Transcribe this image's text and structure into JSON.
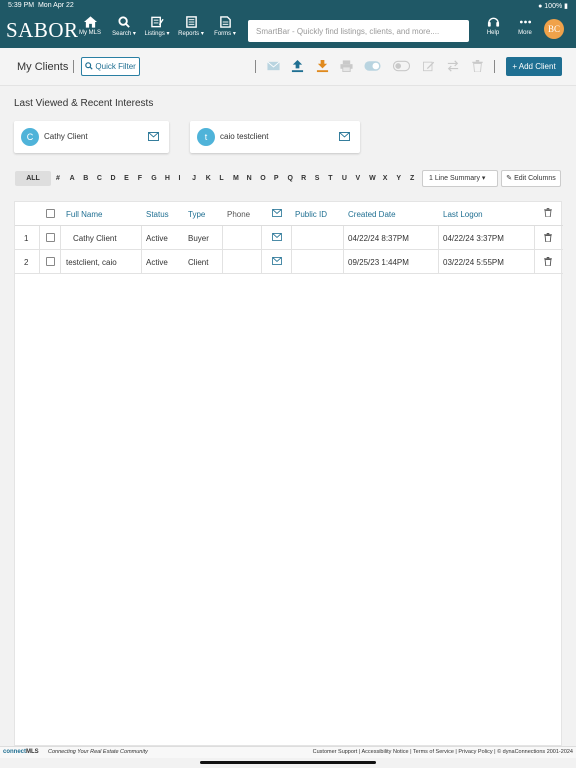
{
  "status_bar": {
    "time": "5:39 PM",
    "date": "Mon Apr 22",
    "battery": "100%"
  },
  "nav": {
    "logo": "SABOR",
    "items": [
      {
        "label": "My MLS",
        "icon": "home-icon"
      },
      {
        "label": "Search ▾",
        "icon": "search-icon"
      },
      {
        "label": "Listings ▾",
        "icon": "listings-icon"
      },
      {
        "label": "Reports ▾",
        "icon": "reports-icon"
      },
      {
        "label": "Forms ▾",
        "icon": "forms-icon"
      }
    ],
    "smartbar_placeholder": "SmartBar - Quickly find listings, clients, and more....",
    "help_label": "Help",
    "more_label": "More",
    "avatar_initials": "BC"
  },
  "toolbar": {
    "title": "My Clients",
    "quick_filter": "Quick Filter",
    "add_client": "+ Add Client",
    "icons": [
      "email-icon",
      "upload-icon",
      "download-icon",
      "print-icon",
      "toggle-on-icon",
      "toggle-off-icon",
      "edit-icon",
      "swap-icon",
      "trash-icon"
    ]
  },
  "recent": {
    "heading": "Last Viewed & Recent Interests",
    "cards": [
      {
        "initial": "C",
        "name": "Cathy Client"
      },
      {
        "initial": "t",
        "name": "caio testclient"
      }
    ]
  },
  "alphabet": {
    "all": "ALL",
    "letters": [
      "#",
      "A",
      "B",
      "C",
      "D",
      "E",
      "F",
      "G",
      "H",
      "I",
      "J",
      "K",
      "L",
      "M",
      "N",
      "O",
      "P",
      "Q",
      "R",
      "S",
      "T",
      "U",
      "V",
      "W",
      "X",
      "Y",
      "Z"
    ],
    "view_select": "1 Line Summary ▾",
    "edit_columns": "Edit Columns"
  },
  "table": {
    "headers": {
      "full_name": "Full Name",
      "status": "Status",
      "type": "Type",
      "phone": "Phone",
      "public_id": "Public ID",
      "created": "Created Date",
      "last_logon": "Last Logon"
    },
    "rows": [
      {
        "num": "1",
        "name": "Cathy Client",
        "status": "Active",
        "type": "Buyer",
        "phone": "",
        "public_id": "",
        "created": "04/22/24 8:37PM",
        "last_logon": "04/22/24 3:37PM"
      },
      {
        "num": "2",
        "name": "testclient, caio",
        "status": "Active",
        "type": "Client",
        "phone": "",
        "public_id": "",
        "created": "09/25/23 1:44PM",
        "last_logon": "03/22/24 5:55PM"
      }
    ]
  },
  "footer": {
    "brand_a": "connect",
    "brand_b": "MLS",
    "tagline": "Connecting Your Real Estate Community",
    "links": "Customer Support | Accessibility Notice | Terms of Service | Privacy Policy | © dynaConnections 2001-2024"
  },
  "colors": {
    "nav_bg": "#1f5866",
    "accent": "#1f6f92",
    "avatar": "#f0a24a",
    "recent_avatar": "#4fb3d9",
    "upload": "#1f6f92",
    "download": "#e08a1e"
  }
}
